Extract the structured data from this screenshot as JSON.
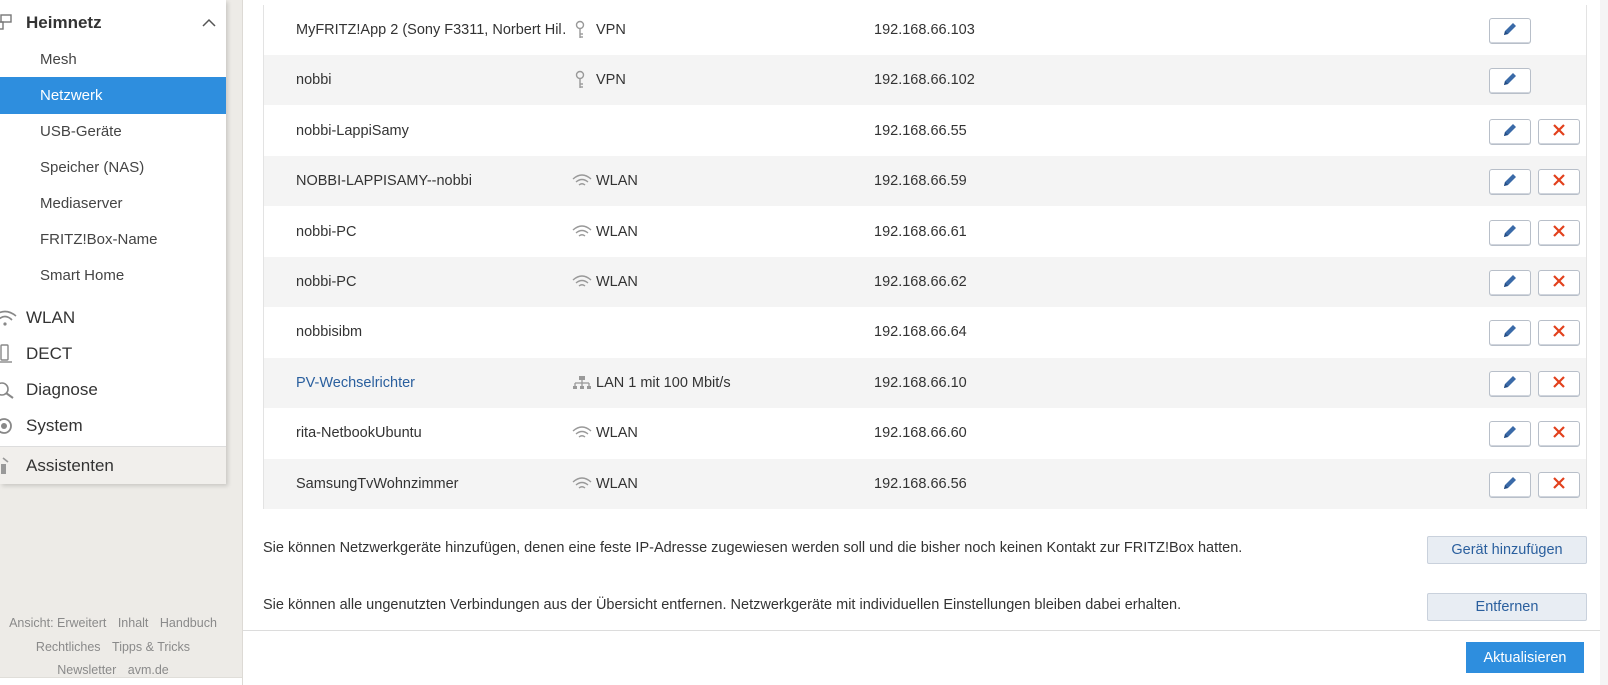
{
  "sidebar": {
    "heimnetz": "Heimnetz",
    "sub_items": [
      "Mesh",
      "Netzwerk",
      "USB-Geräte",
      "Speicher (NAS)",
      "Mediaserver",
      "FRITZ!Box-Name",
      "Smart Home"
    ],
    "active_item": "Netzwerk",
    "wlan": "WLAN",
    "dect": "DECT",
    "diagnose": "Diagnose",
    "system": "System",
    "assistenten": "Assistenten"
  },
  "footer": {
    "ansicht": "Ansicht: Erweitert",
    "inhalt": "Inhalt",
    "handbuch": "Handbuch",
    "rechtliches": "Rechtliches",
    "tipps": "Tipps & Tricks",
    "newsletter": "Newsletter",
    "avm": "avm.de"
  },
  "devices": [
    {
      "name": "MyFRITZ!App 2 (Sony F3311, Norbert Hil…",
      "connection": "VPN",
      "conn_icon": "key-icon",
      "ip": "192.168.66.103",
      "deletable": false,
      "link": false
    },
    {
      "name": "nobbi",
      "connection": "VPN",
      "conn_icon": "key-icon",
      "ip": "192.168.66.102",
      "deletable": false,
      "link": false
    },
    {
      "name": "nobbi-LappiSamy",
      "connection": "",
      "conn_icon": "",
      "ip": "192.168.66.55",
      "deletable": true,
      "link": false
    },
    {
      "name": "NOBBI-LAPPISAMY--nobbi",
      "connection": "WLAN",
      "conn_icon": "wifi-icon",
      "ip": "192.168.66.59",
      "deletable": true,
      "link": false
    },
    {
      "name": "nobbi-PC",
      "connection": "WLAN",
      "conn_icon": "wifi-icon",
      "ip": "192.168.66.61",
      "deletable": true,
      "link": false
    },
    {
      "name": "nobbi-PC",
      "connection": "WLAN",
      "conn_icon": "wifi-icon",
      "ip": "192.168.66.62",
      "deletable": true,
      "link": false
    },
    {
      "name": "nobbisibm",
      "connection": "",
      "conn_icon": "",
      "ip": "192.168.66.64",
      "deletable": true,
      "link": false
    },
    {
      "name": "PV-Wechselrichter",
      "connection": "LAN 1 mit 100 Mbit/s",
      "conn_icon": "lan-icon",
      "ip": "192.168.66.10",
      "deletable": true,
      "link": true
    },
    {
      "name": "rita-NetbookUbuntu",
      "connection": "WLAN",
      "conn_icon": "wifi-icon",
      "ip": "192.168.66.60",
      "deletable": true,
      "link": false
    },
    {
      "name": "SamsungTvWohnzimmer",
      "connection": "WLAN",
      "conn_icon": "wifi-icon",
      "ip": "192.168.66.56",
      "deletable": true,
      "link": false
    }
  ],
  "add_info": "Sie können Netzwerkgeräte hinzufügen, denen eine feste IP-Adresse zugewiesen werden soll und die bisher noch keinen Kontakt zur FRITZ!Box hatten.",
  "add_button": "Gerät hinzufügen",
  "remove_info": "Sie können alle ungenutzten Verbindungen aus der Übersicht entfernen. Netzwerkgeräte mit individuellen Einstellungen bleiben dabei erhalten.",
  "remove_button": "Entfernen",
  "refresh_button": "Aktualisieren",
  "colors": {
    "accent": "#2e8ede",
    "link": "#2a5f9e",
    "delete": "#e2401c"
  }
}
